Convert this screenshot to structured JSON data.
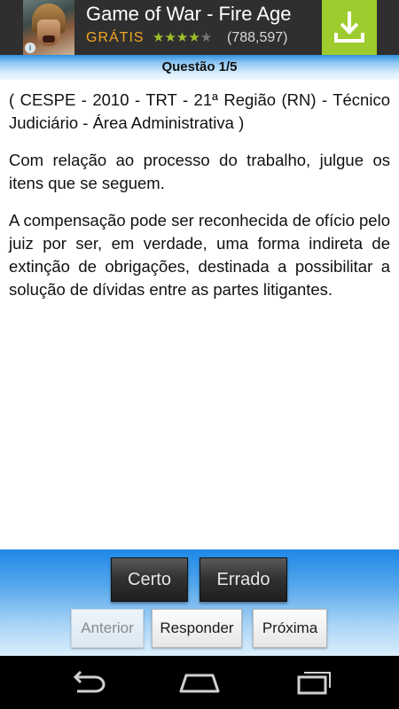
{
  "ad": {
    "title": "Game of War - Fire Age",
    "price": "GRÁTIS",
    "rating_stars": 4,
    "rating_max": 5,
    "rating_count": "(788,597)",
    "info_glyph": "i",
    "icons": [
      "game-thumbnail",
      "info-icon",
      "download-icon"
    ],
    "colors": {
      "accent": "#9ecb2d",
      "price": "#f5a623"
    }
  },
  "header": {
    "title": "Questão 1/5"
  },
  "question": {
    "source": "( CESPE - 2010 - TRT - 21ª Região (RN) - Técnico Judiciário - Área Administrativa )",
    "prompt": "Com relação ao processo do trabalho, julgue os itens que se seguem.",
    "statement": "A compensação pode ser reconhecida de ofício pelo juiz por ser, em verdade, uma forma indireta de extinção de obrigações, destinada a possibilitar a solução de dívidas entre as partes litigantes."
  },
  "answers": {
    "true_label": "Certo",
    "false_label": "Errado"
  },
  "navigation": {
    "previous_label": "Anterior",
    "answer_label": "Responder",
    "next_label": "Próxima",
    "previous_disabled": true
  },
  "system_nav": {
    "icons": [
      "back-icon",
      "home-icon",
      "recent-apps-icon"
    ]
  }
}
